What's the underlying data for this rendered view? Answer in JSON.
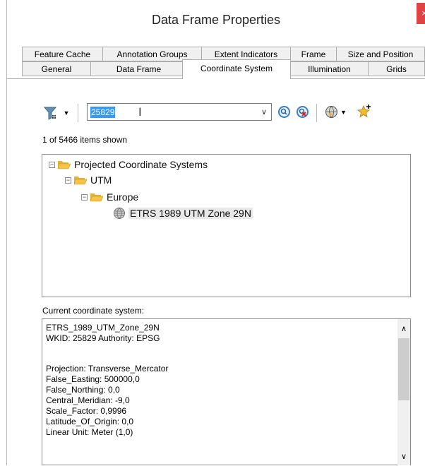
{
  "window": {
    "title": "Data Frame Properties",
    "close_glyph": "×"
  },
  "tabs": {
    "row1": [
      "Feature Cache",
      "Annotation Groups",
      "Extent Indicators",
      "Frame",
      "Size and Position"
    ],
    "row2": [
      "General",
      "Data Frame",
      "Coordinate System",
      "Illumination",
      "Grids"
    ]
  },
  "toolbar": {
    "search_value": "25829",
    "filter_icon": "filter-icon",
    "search_icon": "magnifier-icon",
    "clear_icon": "clear-search-icon",
    "globe_icon": "globe-icon",
    "favorite_icon": "add-favorite-star-icon"
  },
  "count_text": "1 of 5466 items shown",
  "tree": [
    {
      "label": "Projected Coordinate Systems",
      "expander": "−"
    },
    {
      "label": "UTM",
      "expander": "−"
    },
    {
      "label": "Europe",
      "expander": "−"
    },
    {
      "label": "ETRS 1989 UTM Zone 29N"
    }
  ],
  "current": {
    "label": "Current coordinate system:",
    "lines": [
      "ETRS_1989_UTM_Zone_29N",
      "WKID: 25829 Authority: EPSG",
      "",
      "Projection: Transverse_Mercator",
      "False_Easting: 500000,0",
      "False_Northing: 0,0",
      "Central_Meridian: -9,0",
      "Scale_Factor: 0,9996",
      "Latitude_Of_Origin: 0,0",
      "Linear Unit: Meter (1,0)"
    ]
  },
  "scrollbar": {
    "up": "∧",
    "down": "∨"
  },
  "colors": {
    "selection": "#3399ff",
    "close": "#e04343",
    "folder": "#f6c545"
  }
}
